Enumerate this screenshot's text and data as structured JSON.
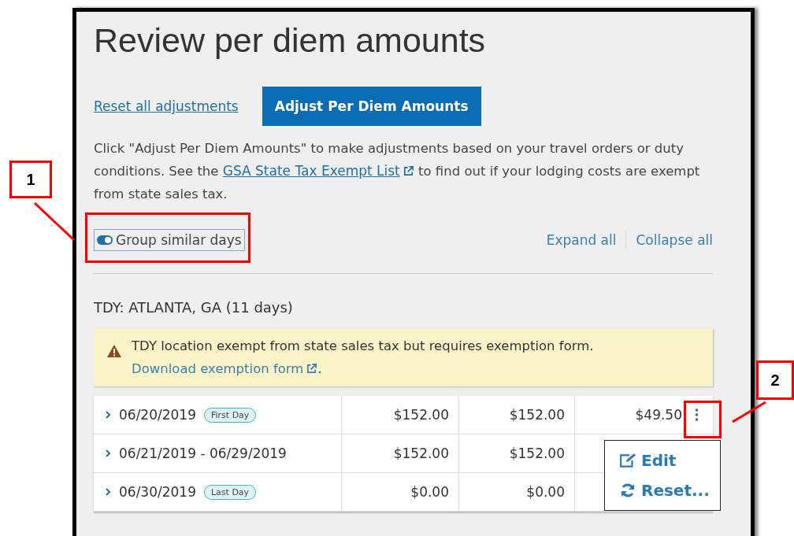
{
  "title": "Review per diem amounts",
  "reset_link": "Reset all adjustments",
  "adjust_button": "Adjust Per Diem Amounts",
  "instructions": {
    "before": "Click \"Adjust Per Diem Amounts\" to make adjustments based on your travel orders or duty conditions. See the ",
    "link": "GSA State Tax Exempt List",
    "after": " to find out if your lodging costs are exempt from state sales tax."
  },
  "group_toggle": {
    "label": "Group similar days",
    "on": true
  },
  "expand_all": "Expand all",
  "collapse_all": "Collapse all",
  "section_heading": "TDY: ATLANTA, GA (11 days)",
  "alert": {
    "before": "TDY location exempt from state sales tax but requires exemption form. ",
    "link": "Download exemption form",
    "after": "."
  },
  "rows": [
    {
      "dates": "06/20/2019",
      "badge": "First Day",
      "column_2": "$152.00",
      "column_3": "$152.00",
      "column_4": "$49.50",
      "menu_open": true
    },
    {
      "dates": "06/21/2019 - 06/29/2019",
      "column_2": "$152.00",
      "column_3": "$152.00"
    },
    {
      "dates": "06/30/2019",
      "badge": "Last Day",
      "column_2": "$0.00",
      "column_3": "$0.00"
    }
  ],
  "row_menu": [
    {
      "kind": "edit",
      "label": "Edit"
    },
    {
      "kind": "reset",
      "label": "Reset..."
    }
  ],
  "callouts": [
    "1",
    "2"
  ]
}
